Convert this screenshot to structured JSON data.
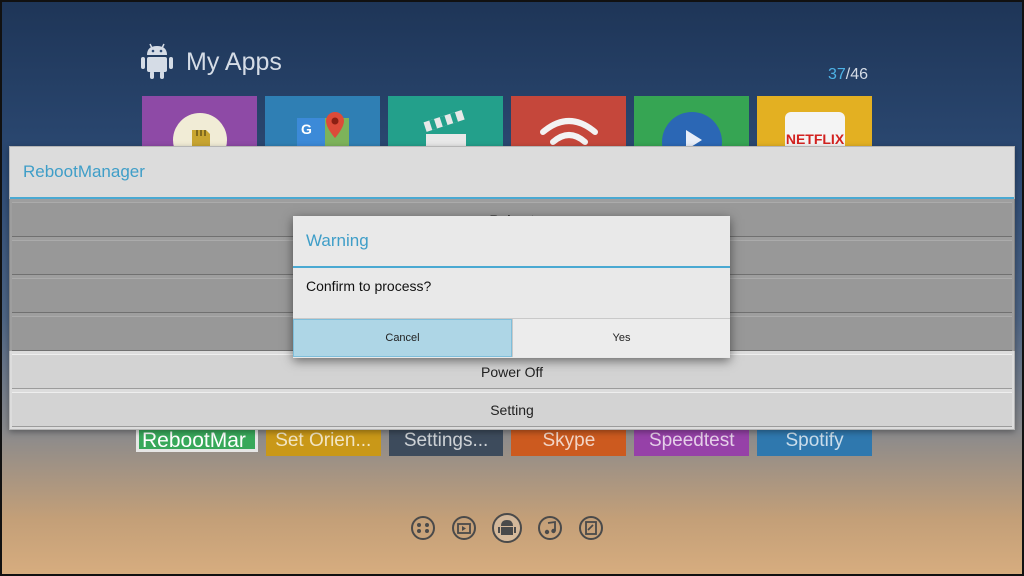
{
  "header": {
    "title": "My Apps",
    "icon": "android-icon",
    "count_current": "37",
    "count_total": "/46"
  },
  "top_tiles": [
    {
      "name": "sd-card-app",
      "color": "#8e4aa6",
      "icon": "sd-card-icon"
    },
    {
      "name": "google-maps-app",
      "color": "#2f7fb4",
      "icon": "google-maps-icon"
    },
    {
      "name": "video-app",
      "color": "#23a08b",
      "icon": "clapperboard-icon"
    },
    {
      "name": "wifi-app",
      "color": "#c5473b",
      "icon": "wifi-icon"
    },
    {
      "name": "play-app",
      "color": "#36a553",
      "icon": "play-icon"
    },
    {
      "name": "netflix-app",
      "color": "#e3b022",
      "icon": "netflix-icon"
    }
  ],
  "bottom_tiles": [
    {
      "label": "RebootMar",
      "color": "#38a85a"
    },
    {
      "label": "Set Orien...",
      "color": "#c99818"
    },
    {
      "label": "Settings...",
      "color": "#3d4b5c"
    },
    {
      "label": "Skype",
      "color": "#cc5a1f"
    },
    {
      "label": "Speedtest",
      "color": "#9641a8"
    },
    {
      "label": "Spotify",
      "color": "#2f78ae"
    }
  ],
  "reboot_manager": {
    "title": "RebootManager",
    "options": [
      "Reboot",
      "",
      "",
      "",
      "Power Off",
      "Setting"
    ]
  },
  "warning_dialog": {
    "title": "Warning",
    "message": "Confirm to process?",
    "cancel_label": "Cancel",
    "yes_label": "Yes"
  },
  "bottom_nav": [
    "apps-grid-icon",
    "media-icon",
    "android-icon",
    "music-icon",
    "files-icon"
  ],
  "colors": {
    "accent": "#3f9ec8",
    "dialog_bg": "#e9e9e9",
    "focused_button": "#aed6e6"
  }
}
